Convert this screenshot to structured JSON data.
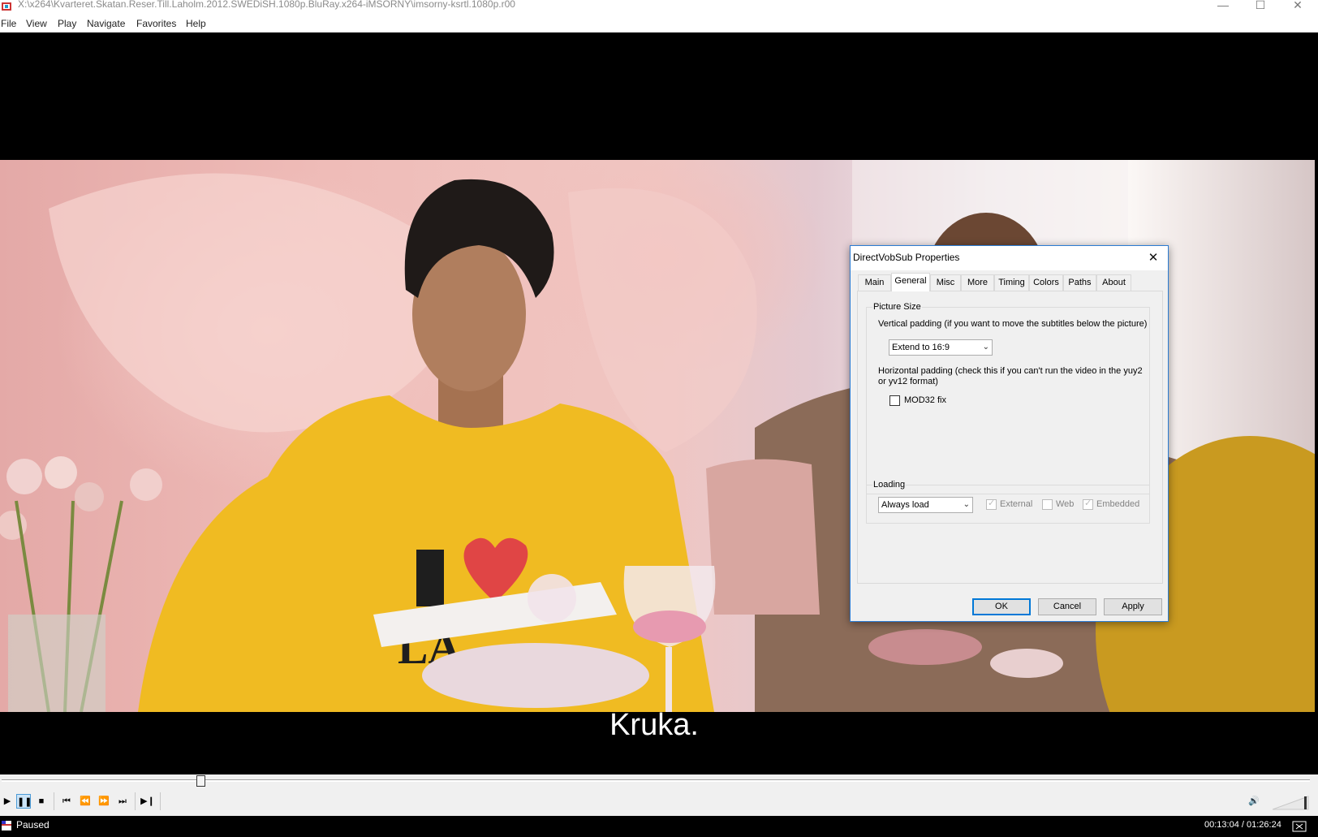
{
  "window": {
    "title": "X:\\x264\\Kvarteret.Skatan.Reser.Till.Laholm.2012.SWEDiSH.1080p.BluRay.x264-iMSORNY\\imsorny-ksrtl.1080p.r00",
    "minimize_glyph": "—",
    "maximize_glyph": "☐",
    "close_glyph": "✕"
  },
  "menu": [
    "File",
    "View",
    "Play",
    "Navigate",
    "Favorites",
    "Help"
  ],
  "video": {
    "subtitle": "Kruka.",
    "shirt_text": "LA"
  },
  "dialog": {
    "title": "DirectVobSub Properties",
    "close_glyph": "✕",
    "tabs": [
      "Main",
      "General",
      "Misc",
      "More",
      "Timing",
      "Colors",
      "Paths",
      "About"
    ],
    "active_tab": "General",
    "picture_size": {
      "legend": "Picture Size",
      "vertical_label": "Vertical padding (if you want to move the subtitles below the picture)",
      "vertical_value": "Extend to 16:9",
      "horizontal_label_line1": "Horizontal padding (check this if you can't run the video in the yuy2",
      "horizontal_label_line2": "or yv12 format)",
      "mod32_label": "MOD32 fix",
      "mod32_checked": false
    },
    "loading": {
      "legend": "Loading",
      "value": "Always load",
      "external_label": "External",
      "external_checked": true,
      "web_label": "Web",
      "web_checked": false,
      "embedded_label": "Embedded",
      "embedded_checked": true
    },
    "buttons": {
      "ok": "OK",
      "cancel": "Cancel",
      "apply": "Apply"
    }
  },
  "player": {
    "seek_position": 0.152,
    "volume": 0.9,
    "status": "Paused",
    "time": "00:13:04 / 01:26:24"
  },
  "icons": {
    "play": "▶",
    "pause": "❚❚",
    "stop": "■",
    "prev": "⏮",
    "rewind": "⏪",
    "forward": "⏩",
    "next": "⏭",
    "frame_step": "▶❙",
    "speaker": "🔊",
    "dropdown": "⌄",
    "check": "✓"
  }
}
